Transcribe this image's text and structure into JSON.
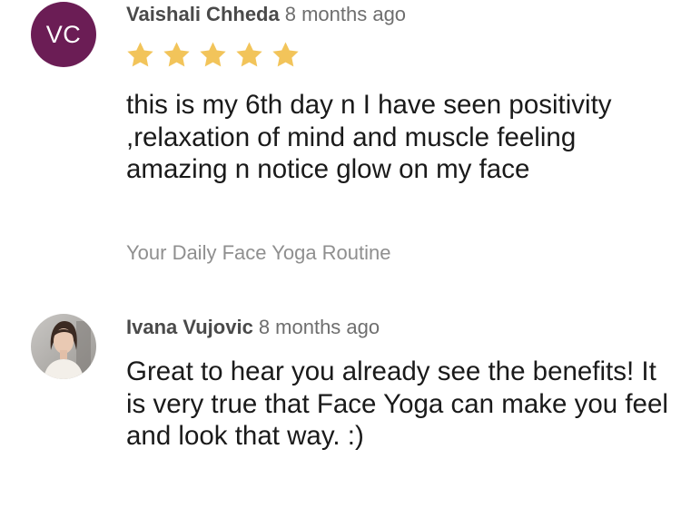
{
  "reviews": [
    {
      "author": "Vaishali Chheda",
      "time": "8 months ago",
      "avatar_initials": "VC",
      "avatar_color": "#6b1d55",
      "rating": 5,
      "text": "this is my 6th day n I have seen positivity ,relaxation of mind and muscle feeling amazing n notice glow on my face",
      "source": "Your Daily Face Yoga Routine"
    },
    {
      "author": "Ivana Vujovic",
      "time": "8 months ago",
      "avatar": "profile-photo",
      "text": "Great to hear you already see the benefits! It is very true that Face Yoga can make you feel and look that way. :)"
    }
  ],
  "colors": {
    "star": "#f2c45a",
    "author": "#4a4a4a",
    "muted": "#8f8f8f"
  }
}
